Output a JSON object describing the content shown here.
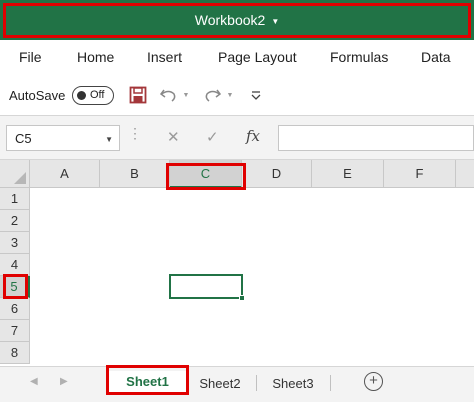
{
  "window": {
    "title": "Workbook2"
  },
  "ribbon": {
    "tabs": [
      "File",
      "Home",
      "Insert",
      "Page Layout",
      "Formulas",
      "Data"
    ]
  },
  "quick_access": {
    "autosave_label": "AutoSave",
    "autosave_state": "Off",
    "icons": [
      "save-icon",
      "undo-icon",
      "redo-icon",
      "customize-qat-icon"
    ]
  },
  "formula_bar": {
    "name_box": "C5",
    "cancel_symbol": "✕",
    "enter_symbol": "✓",
    "fx_label": "fx",
    "formula": ""
  },
  "grid": {
    "columns": [
      "A",
      "B",
      "C",
      "D",
      "E",
      "F"
    ],
    "rows": [
      "1",
      "2",
      "3",
      "4",
      "5",
      "6",
      "7",
      "8"
    ],
    "active_column": "C",
    "active_row": "5"
  },
  "sheets": {
    "tabs": [
      "Sheet1",
      "Sheet2",
      "Sheet3"
    ],
    "active": "Sheet1",
    "add_symbol": "+"
  },
  "colors": {
    "excel_green": "#217346",
    "highlight": "#e00000"
  }
}
